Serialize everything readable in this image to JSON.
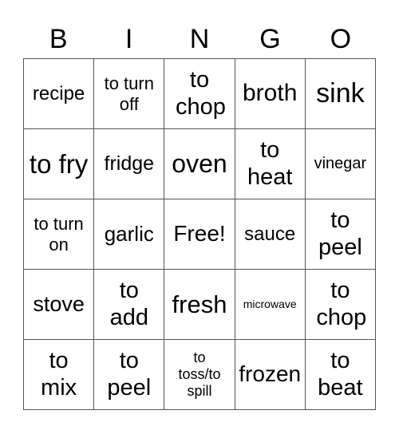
{
  "header": [
    "B",
    "I",
    "N",
    "G",
    "O"
  ],
  "rows": [
    [
      "recipe",
      "to turn off",
      "to chop",
      "broth",
      "sink"
    ],
    [
      "to fry",
      "fridge",
      "oven",
      "to heat",
      "vinegar"
    ],
    [
      "to turn on",
      "garlic",
      "Free!",
      "sauce",
      "to peel"
    ],
    [
      "stove",
      "to add",
      "fresh",
      "microwave",
      "to chop"
    ],
    [
      "to mix",
      "to peel",
      "to toss/to spill",
      "frozen",
      "to beat"
    ]
  ]
}
